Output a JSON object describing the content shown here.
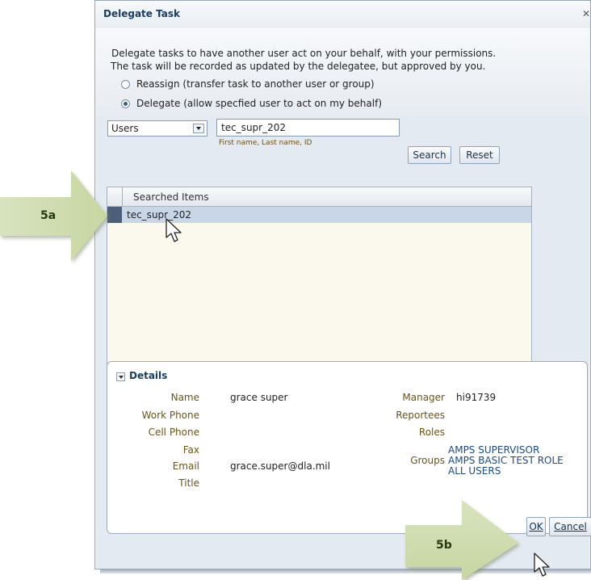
{
  "dialog": {
    "title": "Delegate Task",
    "close_icon": "close-icon"
  },
  "intro": {
    "line1": "Delegate tasks to have another user act on your behalf, with your permissions.",
    "line2": "The task will be recorded as updated by the delegatee, but approved by you."
  },
  "mode_options": [
    {
      "label": "Reassign (transfer task to another user or group)",
      "selected": false
    },
    {
      "label": "Delegate (allow specfied user to act on my behalf)",
      "selected": true
    }
  ],
  "search": {
    "type_value": "Users",
    "query_value": "tec_supr_202",
    "hint": "First name, Last name, ID",
    "search_label": "Search",
    "reset_label": "Reset"
  },
  "results": {
    "column_header": "Searched Items",
    "rows": [
      {
        "name": "tec_supr_202",
        "selected": true
      }
    ]
  },
  "details": {
    "title": "Details",
    "name_label": "Name",
    "name_value": "grace super",
    "work_phone_label": "Work Phone",
    "cell_phone_label": "Cell Phone",
    "fax_label": "Fax",
    "email_label": "Email",
    "email_value": "grace.super@dla.mil",
    "title_label": "Title",
    "manager_label": "Manager",
    "manager_value": "hi91739",
    "reportees_label": "Reportees",
    "roles_label": "Roles",
    "groups_label": "Groups",
    "groups": [
      "AMPS SUPERVISOR",
      "AMPS BASIC TEST ROLE",
      "ALL USERS"
    ]
  },
  "footer": {
    "ok_label": "OK",
    "cancel_label": "Cancel"
  },
  "callouts": {
    "step_a": "5a",
    "step_b": "5b",
    "arrow_color": "#cfdcb0"
  },
  "colors": {
    "title_text": "#1a3e63",
    "selection_row": "#c9d6e6",
    "field_label": "#6a5318",
    "group_link": "#1b4a88"
  }
}
